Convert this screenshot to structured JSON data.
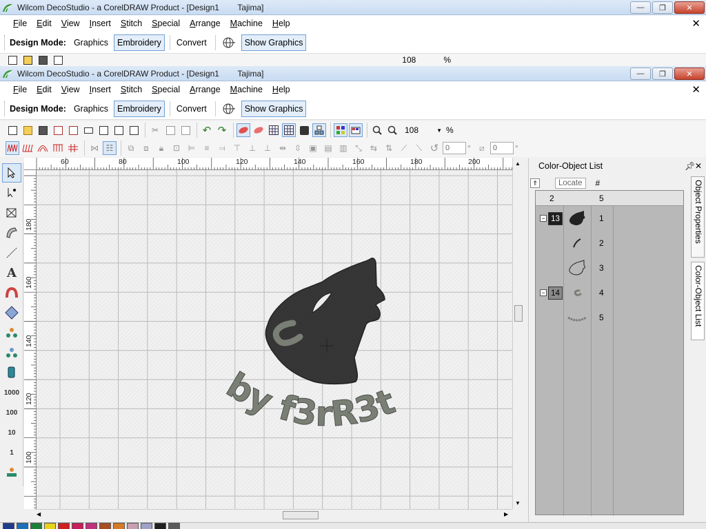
{
  "window_back": {
    "title": "Wilcom DecoStudio - a CorelDRAW Product - [Design1        Tajima]",
    "menu": [
      "File",
      "Edit",
      "View",
      "Insert",
      "Stitch",
      "Special",
      "Arrange",
      "Machine",
      "Help"
    ],
    "mode_label": "Design Mode:",
    "modes": [
      "Graphics",
      "Embroidery",
      "Convert"
    ],
    "show_graphics": "Show Graphics",
    "zoom": "108",
    "percent": "%"
  },
  "window": {
    "title": "Wilcom DecoStudio - a CorelDRAW Product - [Design1        Tajima]",
    "min_glyph": "—",
    "max_glyph": "❐",
    "close_glyph": "✕",
    "mdi_close": "✕"
  },
  "menu": {
    "items": [
      {
        "label": "File",
        "accel": "F"
      },
      {
        "label": "Edit",
        "accel": "E"
      },
      {
        "label": "View",
        "accel": "V"
      },
      {
        "label": "Insert",
        "accel": "I"
      },
      {
        "label": "Stitch",
        "accel": "S"
      },
      {
        "label": "Special",
        "accel": "S"
      },
      {
        "label": "Arrange",
        "accel": "A"
      },
      {
        "label": "Machine",
        "accel": "M"
      },
      {
        "label": "Help",
        "accel": "H"
      }
    ]
  },
  "modebar": {
    "label": "Design Mode:",
    "graphics": "Graphics",
    "embroidery": "Embroidery",
    "convert": "Convert",
    "show_graphics": "Show Graphics"
  },
  "toolbar": {
    "zoom": "108",
    "percent": "%",
    "rotate_value": "0",
    "skew_value": "0",
    "degree": "°"
  },
  "left_tools": {
    "text_tool": "A",
    "scale_1000": "1000",
    "scale_100": "100",
    "scale_10": "10",
    "scale_1": "1"
  },
  "ruler": {
    "top": [
      "60",
      "80",
      "100",
      "120",
      "140",
      "160",
      "180",
      "200"
    ],
    "left": [
      "180",
      "160",
      "140",
      "120",
      "100"
    ]
  },
  "design": {
    "text": "by f3rR3t",
    "colors": {
      "wolf": "#2e2e2e",
      "text": "#7a7f76",
      "accent": "#6fa0d4"
    }
  },
  "panel": {
    "title": "Color-Object List",
    "locate": "Locate",
    "hash": "#",
    "col_count": "2",
    "col_objects": "5",
    "rows": [
      {
        "badge": "13",
        "num": "1"
      },
      {
        "num": "2"
      },
      {
        "num": "3"
      },
      {
        "badge": "14",
        "num": "4"
      },
      {
        "num": "5"
      }
    ],
    "tabs": [
      "Object Properties",
      "Color-Object List"
    ]
  },
  "palette": [
    "#1f3c8c",
    "#1e6fb8",
    "#1b7f3a",
    "#e8d21a",
    "#d02020",
    "#c81e5a",
    "#c0307c",
    "#a84e20",
    "#d77a28",
    "#c8a0b0",
    "#a0a0c8",
    "#202020",
    "#5a5a5a"
  ]
}
